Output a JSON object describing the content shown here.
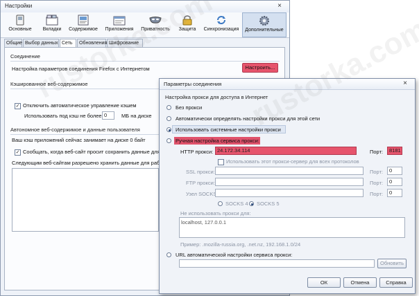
{
  "main_window": {
    "title": "Настройки",
    "close": "×"
  },
  "toolbar": [
    {
      "label": "Основные",
      "icon": "switch-icon"
    },
    {
      "label": "Вкладки",
      "icon": "tabs-icon"
    },
    {
      "label": "Содержимое",
      "icon": "content-icon"
    },
    {
      "label": "Приложения",
      "icon": "applications-icon"
    },
    {
      "label": "Приватность",
      "icon": "mask-icon"
    },
    {
      "label": "Защита",
      "icon": "lock-icon"
    },
    {
      "label": "Синхронизация",
      "icon": "sync-icon"
    },
    {
      "label": "Дополнительные",
      "icon": "gear-icon",
      "selected": true
    }
  ],
  "tabs": [
    {
      "label": "Общие"
    },
    {
      "label": "Выбор данных"
    },
    {
      "label": "Сеть",
      "selected": true
    },
    {
      "label": "Обновления"
    },
    {
      "label": "Шифрование"
    }
  ],
  "network": {
    "connection_title": "Соединение",
    "connection_text": "Настройка параметров соединения Firefox с Интернетом",
    "configure_button": "Настроить...",
    "cache_title": "Кэшированное веб-содержимое",
    "cache_override": "Отключить автоматическое управление кэшем",
    "cache_limit_label": "Использовать под кэш не более",
    "cache_limit_value": "0",
    "cache_limit_unit": "МБ на диске",
    "offline_title": "Автономное веб-содержимое и данные пользователя",
    "offline_usage": "Ваш кэш приложений сейчас занимает на диске 0 байт",
    "offline_notify": "Сообщать, когда веб-сайт просит сохранить данные для автономной",
    "offline_allowed": "Следующим веб-сайтам разрешено хранить данные для работы в автономном"
  },
  "dialog": {
    "title": "Параметры соединения",
    "close": "×",
    "section_title": "Настройка прокси для доступа в Интернет",
    "options": [
      {
        "label": "Без прокси",
        "checked": false
      },
      {
        "label": "Автоматически определять настройки прокси для этой сети",
        "checked": false
      },
      {
        "label": "Использовать системные настройки прокси",
        "checked": true
      },
      {
        "label": "Ручная настройка сервиса прокси:",
        "checked": false
      }
    ],
    "http_label": "HTTP прокси:",
    "http_value": "24.172.34.114",
    "port_label": "Порт:",
    "http_port": "8181",
    "use_for_all": "Использовать этот прокси-сервер для всех протоколов",
    "ssl_label": "SSL прокси:",
    "ftp_label": "FTP прокси:",
    "socks_label": "Узел SOCKS:",
    "port_zero": "0",
    "socks4": "SOCKS 4",
    "socks5": "SOCKS 5",
    "no_proxy_label": "Не использовать прокси для:",
    "no_proxy_value": "localhost, 127.0.0.1",
    "example": "Пример: .mozilla-russia.org, .net.nz, 192.168.1.0/24",
    "auto_url_label": "URL автоматической настройки сервиса прокси:",
    "refresh_button": "Обновить",
    "ok_button": "ОК",
    "cancel_button": "Отмена",
    "help_button": "Справка"
  },
  "watermark": "rustorka.com"
}
